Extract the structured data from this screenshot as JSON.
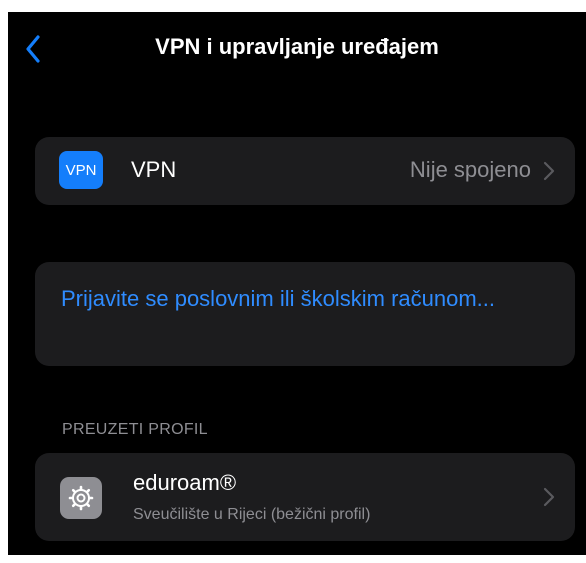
{
  "nav": {
    "title": "VPN i upravljanje uređajem",
    "back_icon": "chevron-left-icon"
  },
  "vpn_row": {
    "badge_text": "VPN",
    "label": "VPN",
    "status": "Nije spojeno",
    "chevron_icon": "chevron-right-icon"
  },
  "sign_in": {
    "label": "Prijavite se poslovnim ili školskim računom..."
  },
  "downloaded_profile": {
    "header": "PREUZETI PROFIL",
    "name": "eduroam®",
    "subtitle": "Sveučilište u Rijeci (bežični profil)",
    "icon": "gear-icon",
    "chevron_icon": "chevron-right-icon"
  },
  "colors": {
    "background": "#000000",
    "card": "#1c1c1e",
    "accent": "#2f8cff",
    "vpn_badge": "#147efb",
    "secondary_text": "#8e8e93"
  }
}
